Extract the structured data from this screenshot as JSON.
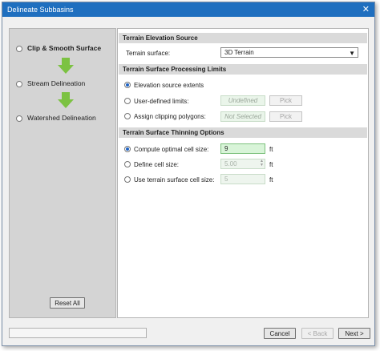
{
  "window": {
    "title": "Delineate Subbasins",
    "close_glyph": "✕"
  },
  "steps": [
    {
      "label": "Clip & Smooth Surface",
      "active": true
    },
    {
      "label": "Stream Delineation",
      "active": false
    },
    {
      "label": "Watershed Delineation",
      "active": false
    }
  ],
  "left": {
    "reset_label": "Reset All"
  },
  "elevation": {
    "header": "Terrain Elevation Source",
    "surface_label": "Terrain surface:",
    "surface_value": "3D Terrain"
  },
  "limits": {
    "header": "Terrain Surface Processing Limits",
    "opt_source": "Elevation source extents",
    "opt_user": "User-defined limits:",
    "user_value": "Undefined",
    "opt_polygons": "Assign clipping polygons:",
    "polygons_value": "Not Selected",
    "pick_label": "Pick"
  },
  "thinning": {
    "header": "Terrain Surface Thinning Options",
    "opt_optimal": "Compute optimal cell size:",
    "optimal_value": "9",
    "opt_define": "Define cell size:",
    "define_value": "5.00",
    "opt_surface": "Use terrain surface cell size:",
    "surface_value": "5",
    "unit": "ft"
  },
  "footer": {
    "cancel": "Cancel",
    "back": "< Back",
    "next": "Next >"
  },
  "colors": {
    "titlebar": "#1f6fbf",
    "arrow": "#7cc242",
    "selected_field": "#d8f4d8"
  }
}
